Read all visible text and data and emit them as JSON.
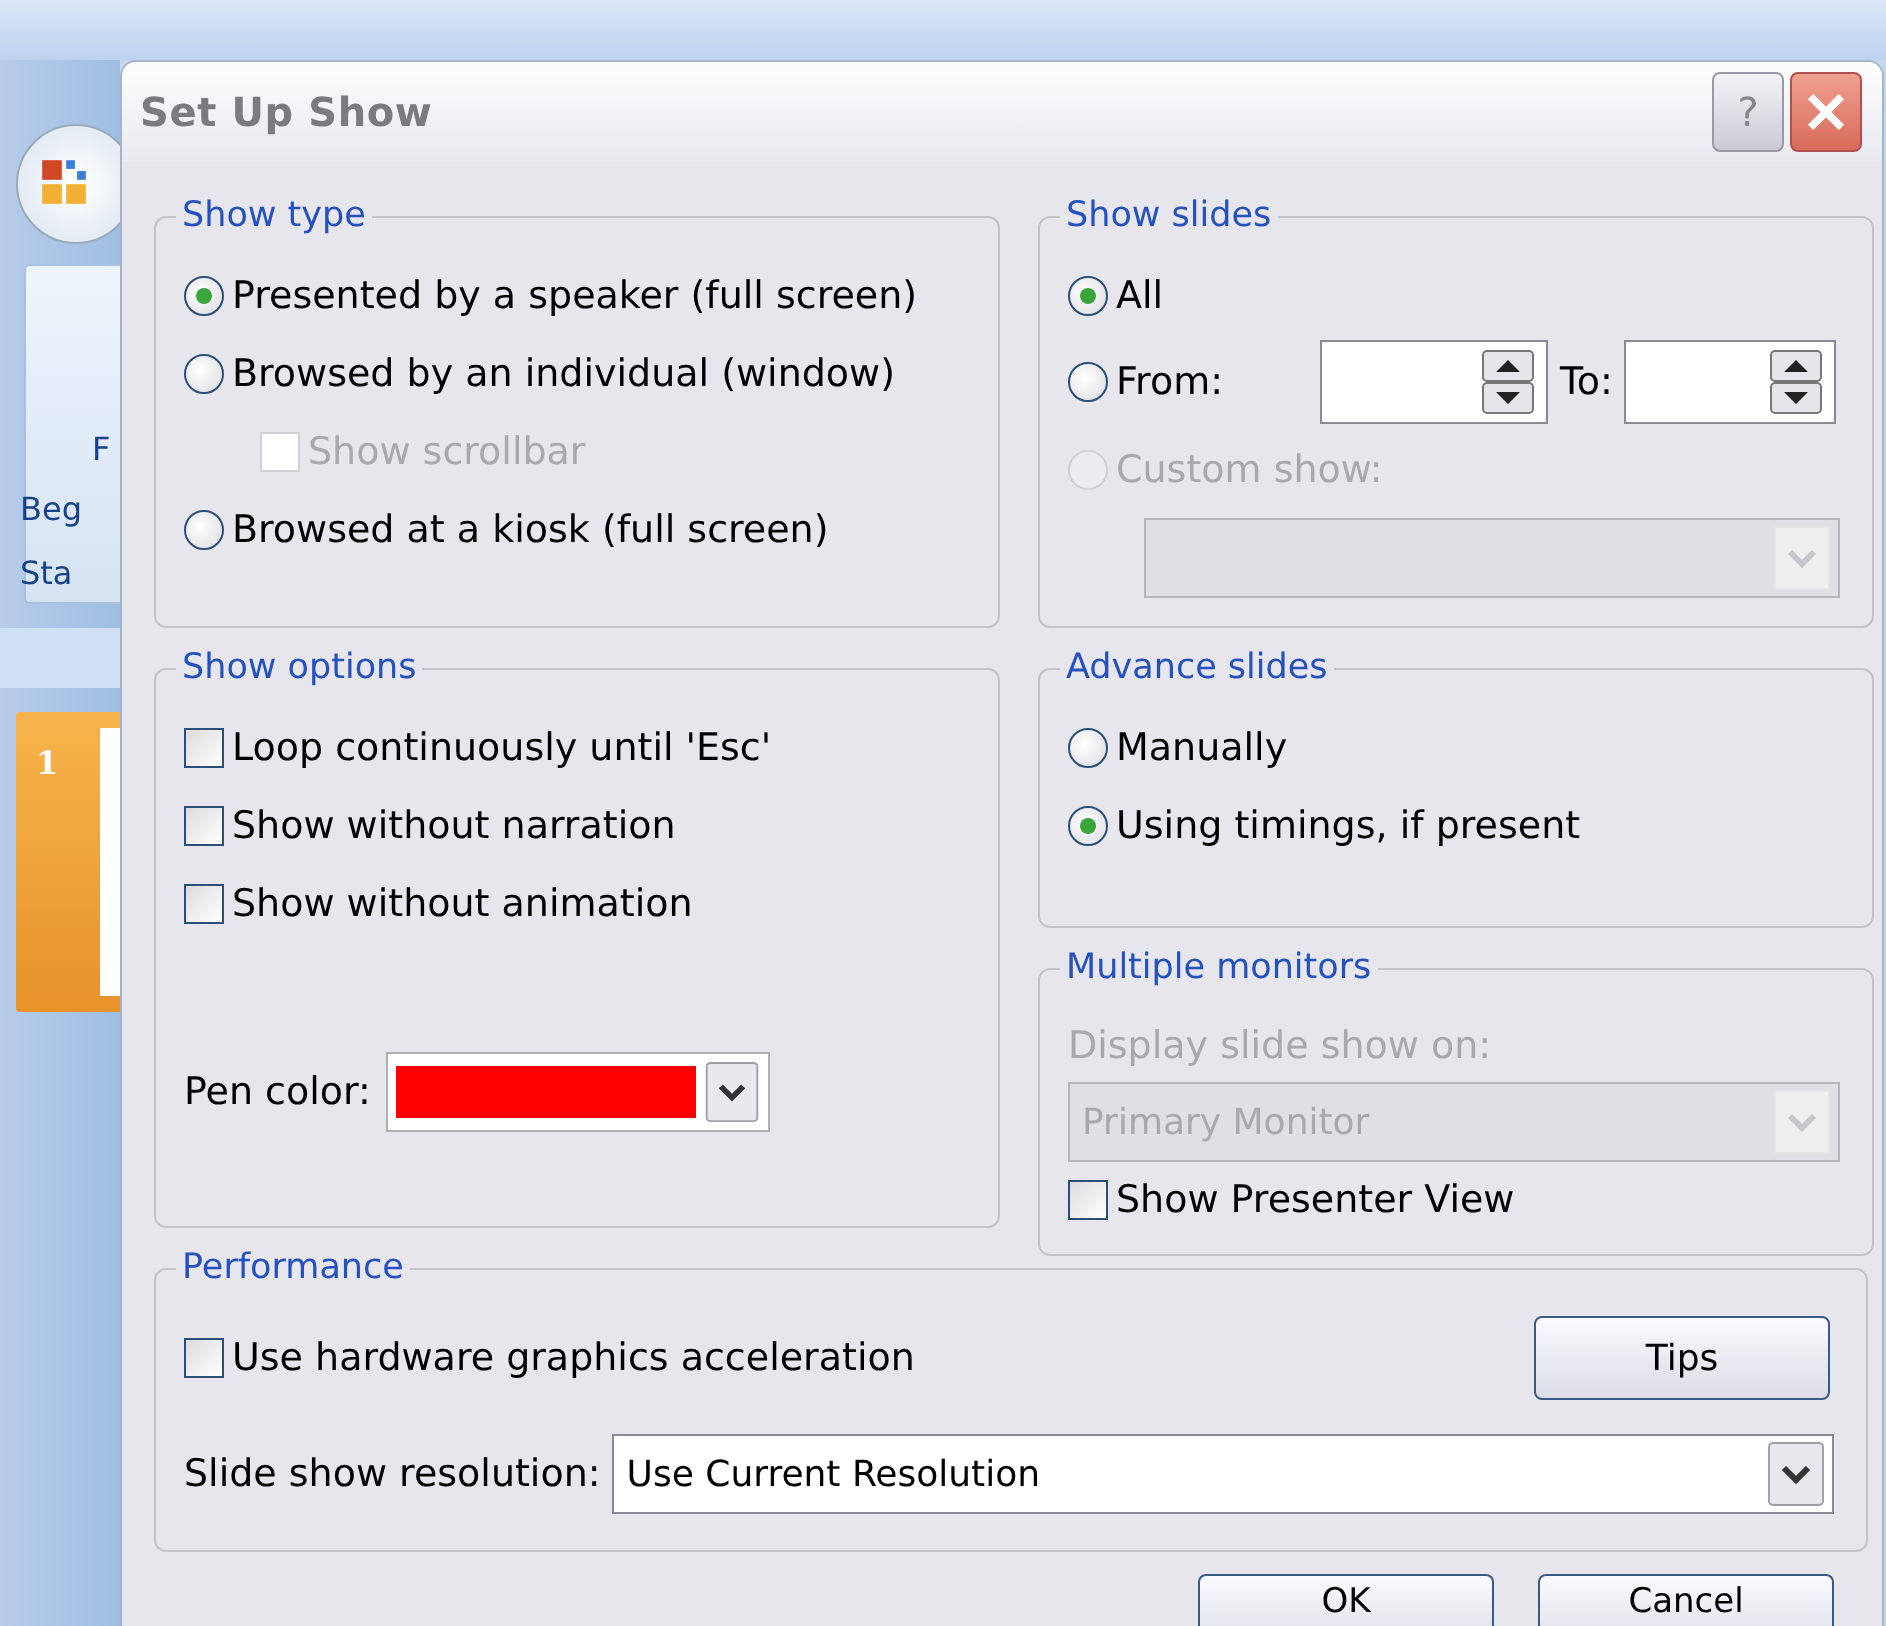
{
  "app": {
    "ribbon_texts": [
      "F",
      "Beg",
      "Sta"
    ],
    "slide_number": "1"
  },
  "dialog": {
    "title": "Set Up Show",
    "help_button": "?",
    "columns": [
      [
        {
          "title": "Show type",
          "items": [
            {
              "kind": "radio",
              "label": "Presented by a speaker (full screen)",
              "selected": true,
              "disabled": false
            },
            {
              "kind": "radio",
              "label": "Browsed by an individual (window)",
              "selected": false,
              "disabled": false
            },
            {
              "kind": "sub_checkbox",
              "label": "Show scrollbar",
              "checked": false,
              "disabled": true
            },
            {
              "kind": "radio",
              "label": "Browsed at a kiosk (full screen)",
              "selected": false,
              "disabled": false
            }
          ]
        },
        {
          "title": "Show options",
          "items": [
            {
              "kind": "checkbox",
              "label": "Loop continuously until 'Esc'",
              "checked": false,
              "disabled": false
            },
            {
              "kind": "checkbox",
              "label": "Show without narration",
              "checked": false,
              "disabled": false
            },
            {
              "kind": "checkbox",
              "label": "Show without animation",
              "checked": false,
              "disabled": false
            },
            {
              "kind": "color",
              "label": "Pen color:",
              "color": "#ff0000"
            }
          ]
        }
      ],
      [
        {
          "title": "Show slides",
          "items": [
            {
              "kind": "radio",
              "label": "All",
              "selected": true,
              "disabled": false
            },
            {
              "kind": "range",
              "label": "From:",
              "to_label": "To:",
              "selected": false,
              "disabled": false
            },
            {
              "kind": "radio",
              "label": "Custom show:",
              "selected": false,
              "disabled": true
            },
            {
              "kind": "combo",
              "disabled": true
            }
          ]
        },
        {
          "title": "Advance slides",
          "items": [
            {
              "kind": "radio",
              "label": "Manually",
              "selected": false,
              "disabled": false
            },
            {
              "kind": "radio",
              "label": "Using timings, if present",
              "selected": true,
              "disabled": false
            }
          ]
        },
        {
          "title": "Multiple monitors",
          "items": [
            {
              "kind": "caption",
              "label": "Display slide show on:",
              "disabled": true
            },
            {
              "kind": "combo",
              "value": "Primary Monitor",
              "disabled": true
            },
            {
              "kind": "checkbox",
              "label": "Show Presenter View",
              "checked": false,
              "disabled": false
            }
          ]
        }
      ]
    ],
    "performance": {
      "title": "Performance",
      "items": [
        {
          "kind": "check_button",
          "label": "Use hardware graphics acceleration",
          "checked": false,
          "button": "Tips"
        },
        {
          "kind": "select_row",
          "label": "Slide show resolution:",
          "value": "Use Current Resolution"
        }
      ]
    },
    "buttons": [
      "OK",
      "Cancel"
    ]
  }
}
